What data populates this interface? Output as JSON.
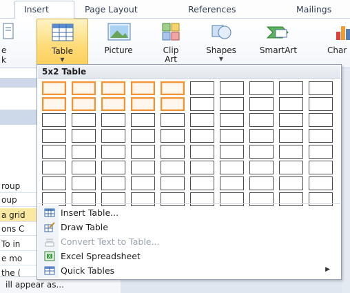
{
  "tabs": {
    "insert": "Insert",
    "page_layout": "Page Layout",
    "references": "References",
    "mailings": "Mailings"
  },
  "ribbon": {
    "left_partial_top": "e",
    "left_partial_bottom": "k",
    "table": "Table",
    "picture": "Picture",
    "clip_art_1": "Clip",
    "clip_art_2": "Art",
    "shapes": "Shapes",
    "smartart": "SmartArt",
    "chart_partial": "Char"
  },
  "dropdown": {
    "header": "5x2 Table",
    "grid": {
      "cols": 10,
      "rows": 8,
      "selected_cols": 5,
      "selected_rows": 2
    },
    "menu": [
      {
        "label": "Insert Table...",
        "icon": "insert-table-icon",
        "disabled": false
      },
      {
        "label": "Draw Table",
        "icon": "draw-table-icon",
        "disabled": false
      },
      {
        "label": "Convert Text to Table...",
        "icon": "convert-text-icon",
        "disabled": true
      },
      {
        "label": "Excel Spreadsheet",
        "icon": "excel-icon",
        "disabled": false
      },
      {
        "label": "Quick Tables",
        "icon": "quick-tables-icon",
        "disabled": false,
        "submenu": true
      }
    ]
  },
  "left_panel": {
    "lines": [
      "roup",
      "oup",
      "a grid",
      "ons C",
      "To in",
      "e mo",
      "the (",
      "ill appear as..."
    ]
  },
  "colors": {
    "selection_border": "#f29436",
    "table_button_fill": "#fedc7a"
  }
}
